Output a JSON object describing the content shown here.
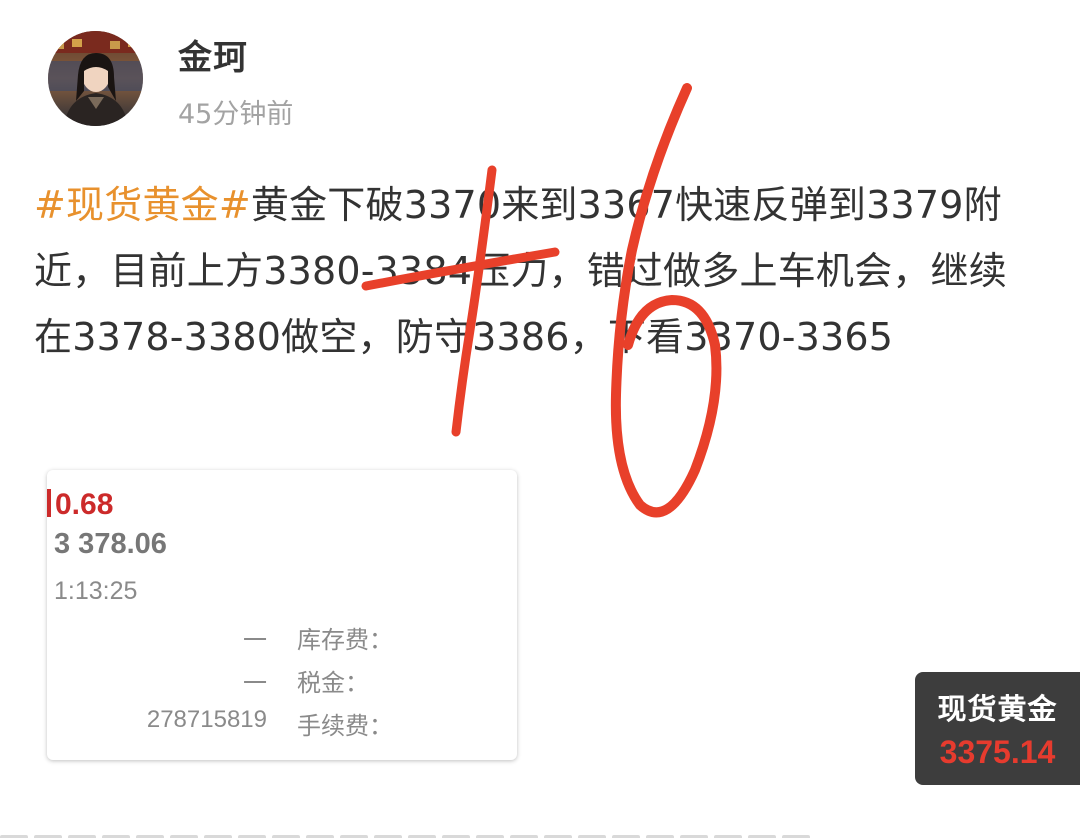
{
  "post": {
    "author": "金珂",
    "time_ago": "45分钟前",
    "hashtag": "#现货黄金#",
    "body": "黄金下破3370来到3367快速反弹到3379附近，目前上方3380-3384压力，错过做多上车机会，继续在3378-3380做空，防守3386，下看3370-3365"
  },
  "trade_card": {
    "change": "0.68",
    "price": "3 378.06",
    "time": "1:13:25",
    "fees": [
      {
        "value": "一",
        "label": "库存费："
      },
      {
        "value": "一",
        "label": "税金："
      },
      {
        "value": "278715819",
        "label": "手续费："
      }
    ]
  },
  "ticker": {
    "name": "现货黄金",
    "price": "3375.14"
  },
  "overlay": {
    "handwriting": "+6",
    "color": "#e8402a"
  },
  "colors": {
    "hashtag": "#e8912d",
    "text": "#333333",
    "muted": "#a3a3a3",
    "ticker_bg": "#3d3d3d",
    "ticker_price": "#e63b2e",
    "trade_change": "#cc2a2a"
  },
  "icons": {
    "avatar": "avatar-photo",
    "change_bar": "change-bar-icon"
  }
}
